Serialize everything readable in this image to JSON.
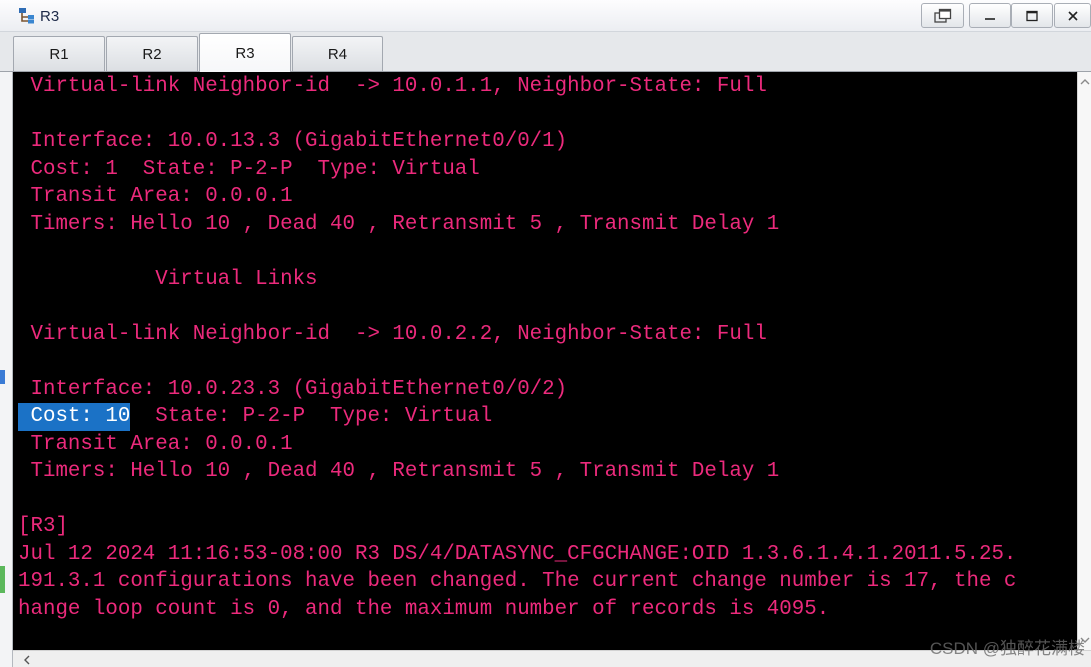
{
  "window": {
    "title": "R3",
    "app_icon": "network-topology-icon",
    "controls": [
      {
        "name": "restore-tab",
        "icon": "detach-window-icon"
      },
      {
        "name": "minimize",
        "icon": "minimize-icon"
      },
      {
        "name": "maximize",
        "icon": "maximize-icon"
      },
      {
        "name": "close",
        "icon": "close-icon"
      }
    ]
  },
  "tabs": [
    {
      "label": "R1",
      "active": false
    },
    {
      "label": "R2",
      "active": false
    },
    {
      "label": "R3",
      "active": true
    },
    {
      "label": "R4",
      "active": false
    }
  ],
  "theme": {
    "terminal_bg": "#000000",
    "terminal_text": "#ec2a7c",
    "selection_bg": "#1b72c6",
    "selection_text": "#ffffff"
  },
  "terminal": {
    "lines": [
      {
        "text": " Virtual-link Neighbor-id  -> 10.0.1.1, Neighbor-State: Full"
      },
      {
        "text": ""
      },
      {
        "text": " Interface: 10.0.13.3 (GigabitEthernet0/0/1)"
      },
      {
        "text": " Cost: 1  State: P-2-P  Type: Virtual"
      },
      {
        "text": " Transit Area: 0.0.0.1"
      },
      {
        "text": " Timers: Hello 10 , Dead 40 , Retransmit 5 , Transmit Delay 1"
      },
      {
        "text": ""
      },
      {
        "text": "           Virtual Links"
      },
      {
        "text": ""
      },
      {
        "text": " Virtual-link Neighbor-id  -> 10.0.2.2, Neighbor-State: Full"
      },
      {
        "text": ""
      },
      {
        "text": " Interface: 10.0.23.3 (GigabitEthernet0/0/2)"
      },
      {
        "selected": " Cost: 10",
        "text": "  State: P-2-P  Type: Virtual"
      },
      {
        "text": " Transit Area: 0.0.0.1"
      },
      {
        "text": " Timers: Hello 10 , Dead 40 , Retransmit 5 , Transmit Delay 1"
      },
      {
        "text": ""
      },
      {
        "text": "[R3]"
      },
      {
        "text": "Jul 12 2024 11:16:53-08:00 R3 DS/4/DATASYNC_CFGCHANGE:OID 1.3.6.1.4.1.2011.5.25."
      },
      {
        "text": "191.3.1 configurations have been changed. The current change number is 17, the c"
      },
      {
        "text": "hange loop count is 0, and the maximum number of records is 4095."
      }
    ]
  },
  "scrollbars": {
    "vertical": {
      "up_icon": "chevron-up-icon",
      "down_icon": "chevron-down-icon"
    },
    "horizontal": {
      "left_icon": "chevron-left-icon"
    }
  },
  "watermark": "CSDN @独醉花满楼"
}
